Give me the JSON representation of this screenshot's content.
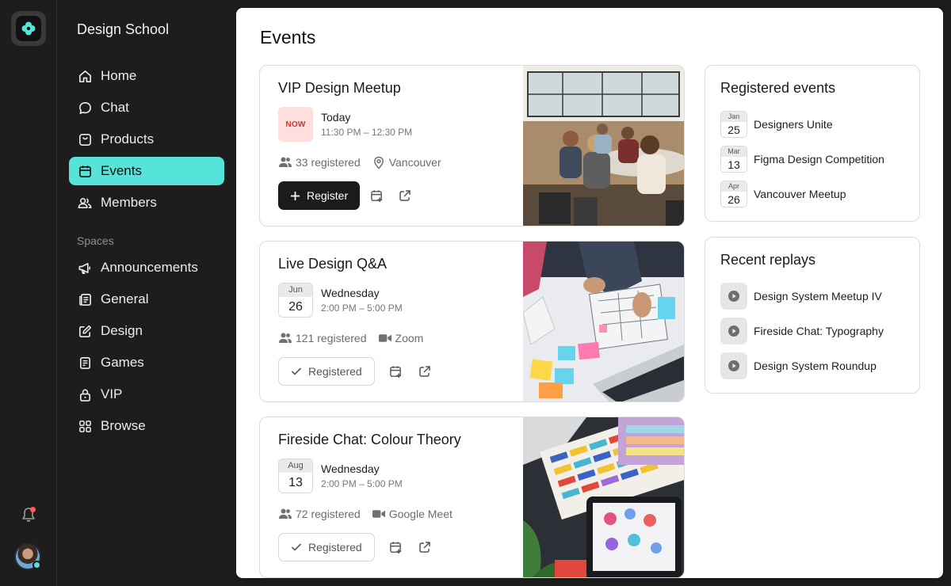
{
  "app": {
    "name": "Design School"
  },
  "nav": {
    "items": [
      {
        "label": "Home",
        "icon": "home-icon"
      },
      {
        "label": "Chat",
        "icon": "chat-icon"
      },
      {
        "label": "Products",
        "icon": "bag-icon"
      },
      {
        "label": "Events",
        "icon": "calendar-icon",
        "active": true
      },
      {
        "label": "Members",
        "icon": "users-icon"
      }
    ],
    "spaces_label": "Spaces",
    "spaces": [
      {
        "label": "Announcements",
        "icon": "megaphone-icon"
      },
      {
        "label": "General",
        "icon": "document-icon"
      },
      {
        "label": "Design",
        "icon": "edit-icon"
      },
      {
        "label": "Games",
        "icon": "controller-icon"
      },
      {
        "label": "VIP",
        "icon": "lock-icon"
      },
      {
        "label": "Browse",
        "icon": "grid-icon"
      }
    ]
  },
  "page": {
    "title": "Events"
  },
  "events": [
    {
      "title": "VIP Design Meetup",
      "badge": "NOW",
      "day_label": "Today",
      "time": "11:30 PM – 12:30 PM",
      "registered": "33 registered",
      "location": "Vancouver",
      "location_icon": "pin-icon",
      "action_label": "Register",
      "is_registered": false
    },
    {
      "title": "Live Design Q&A",
      "month": "Jun",
      "day": "26",
      "day_label": "Wednesday",
      "time": "2:00 PM – 5:00 PM",
      "registered": "121 registered",
      "location": "Zoom",
      "location_icon": "video-icon",
      "action_label": "Registered",
      "is_registered": true
    },
    {
      "title": "Fireside Chat: Colour Theory",
      "month": "Aug",
      "day": "13",
      "day_label": "Wednesday",
      "time": "2:00 PM – 5:00 PM",
      "registered": "72 registered",
      "location": "Google Meet",
      "location_icon": "video-icon",
      "action_label": "Registered",
      "is_registered": true
    }
  ],
  "registered_events": {
    "title": "Registered events",
    "items": [
      {
        "month": "Jan",
        "day": "25",
        "label": "Designers Unite"
      },
      {
        "month": "Mar",
        "day": "13",
        "label": "Figma Design Competition"
      },
      {
        "month": "Apr",
        "day": "26",
        "label": "Vancouver Meetup"
      }
    ]
  },
  "recent_replays": {
    "title": "Recent replays",
    "items": [
      {
        "label": "Design System Meetup IV"
      },
      {
        "label": "Fireside Chat: Typography"
      },
      {
        "label": "Design System Roundup"
      }
    ]
  },
  "colors": {
    "accent": "#56e3da",
    "dark": "#1b1b1b",
    "now_bg": "#ffdede",
    "now_text": "#d83434"
  }
}
